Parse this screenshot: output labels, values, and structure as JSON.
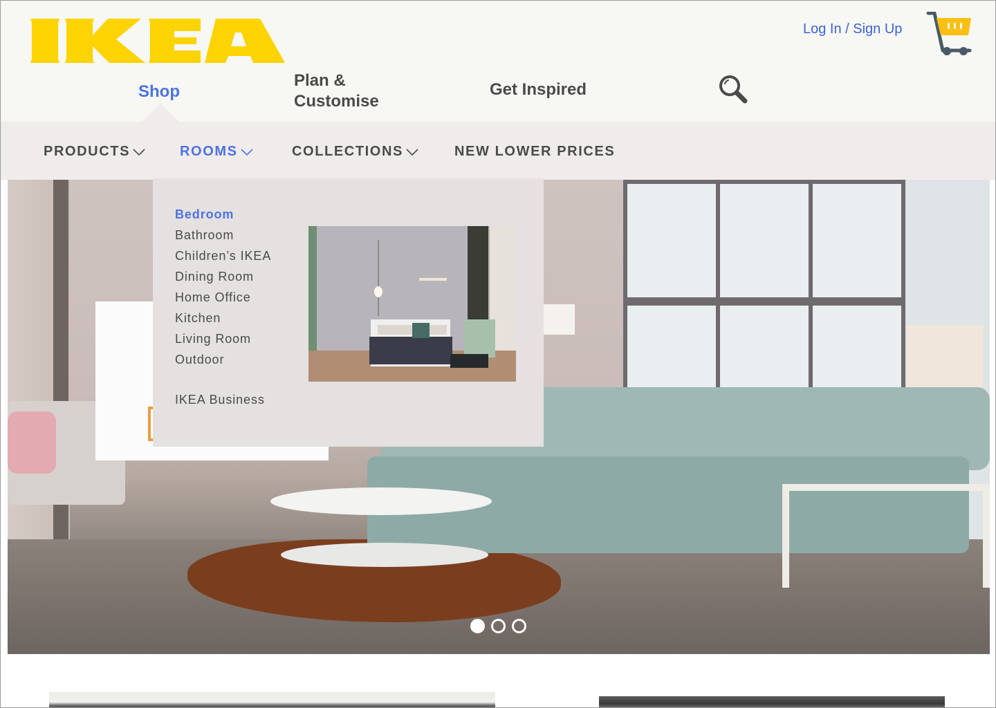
{
  "brand": {
    "logo_text": "IKEA",
    "logo_color": "#fdd300"
  },
  "header": {
    "auth_link": "Log In / Sign Up",
    "cart_icon": "shopping-cart-icon",
    "search_icon": "search-icon"
  },
  "main_nav": [
    {
      "label": "Shop",
      "active": true
    },
    {
      "label": "Plan &",
      "label2": "Customise",
      "active": false
    },
    {
      "label": "Get Inspired",
      "active": false
    }
  ],
  "sub_nav": [
    {
      "label": "PRODUCTS",
      "has_dropdown": true,
      "active": false
    },
    {
      "label": "ROOMS",
      "has_dropdown": true,
      "active": true
    },
    {
      "label": "COLLECTIONS",
      "has_dropdown": true,
      "active": false
    },
    {
      "label": "NEW LOWER PRICES",
      "has_dropdown": false,
      "active": false
    }
  ],
  "rooms_dropdown": {
    "items": [
      {
        "label": "Bedroom",
        "active": true
      },
      {
        "label": "Bathroom"
      },
      {
        "label": "Children’s IKEA"
      },
      {
        "label": "Dining Room"
      },
      {
        "label": "Home Office"
      },
      {
        "label": "Kitchen"
      },
      {
        "label": "Living Room"
      },
      {
        "label": "Outdoor"
      }
    ],
    "extra_item": "IKEA Business",
    "preview_image": "bedroom-photo"
  },
  "hero": {
    "image": "living-room-photo",
    "carousel": {
      "total": 3,
      "active_index": 0
    }
  },
  "colors": {
    "accent_blue": "#4d72e3",
    "link_blue": "#3c63d6",
    "text_dark": "#4a4a4a",
    "header_bg": "#f7f7f3",
    "subnav_bg": "#f0eceb",
    "dropdown_bg": "#e5e1e0",
    "cart_yellow": "#fbbf14"
  }
}
